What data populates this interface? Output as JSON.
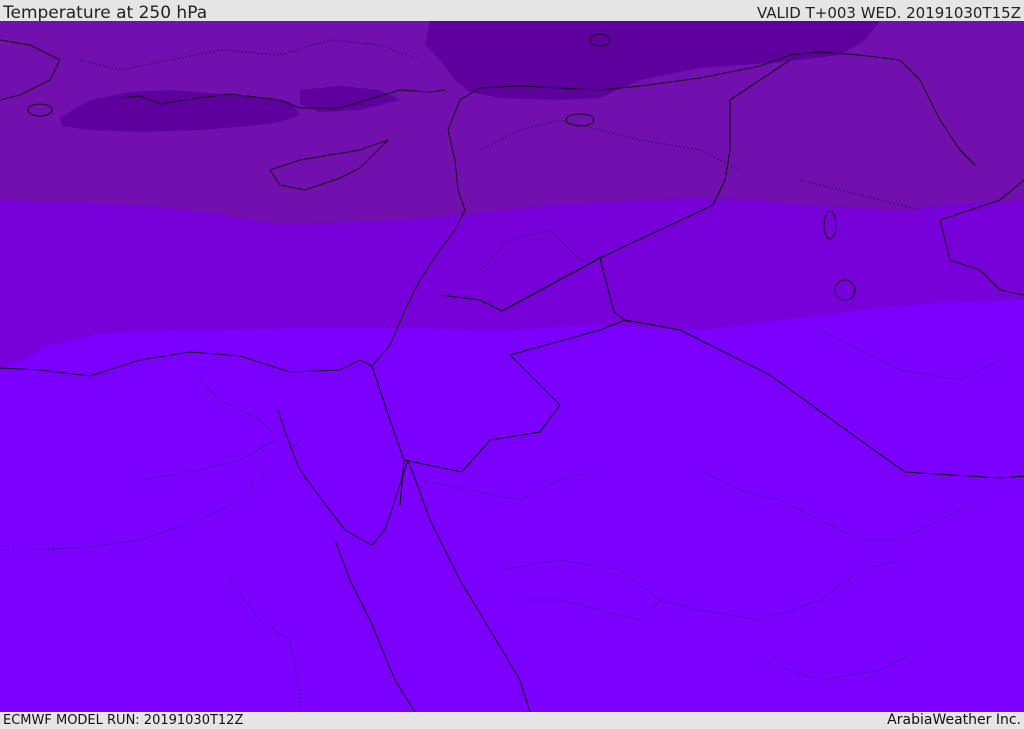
{
  "header": {
    "title": "Temperature at 250 hPa",
    "valid_time": "VALID T+003 WED. 20191030T15Z"
  },
  "footer": {
    "model_run": "ECMWF MODEL RUN: 20191030T12Z",
    "credit": "ArabiaWeather Inc."
  },
  "map": {
    "field": "temperature",
    "level": "250 hPa",
    "colors": {
      "coldest": "#5e009e",
      "cold": "#720faf",
      "mid": "#7800d8",
      "warm": "#7b00ff",
      "coast": "#111111",
      "border": "#000000"
    }
  }
}
